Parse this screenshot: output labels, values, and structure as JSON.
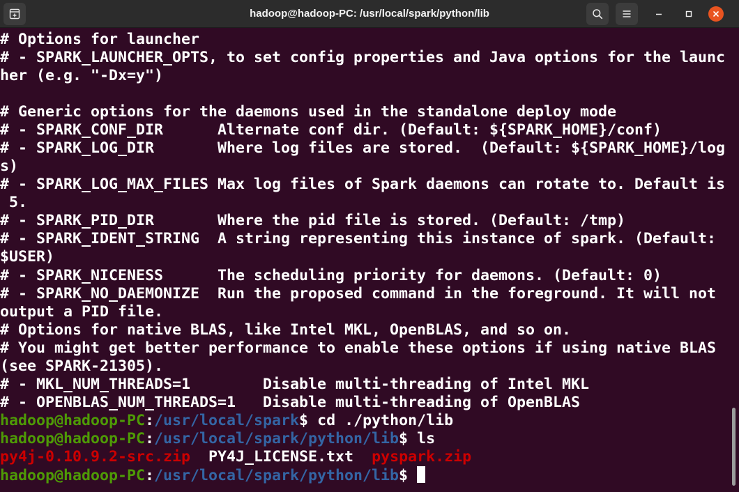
{
  "window": {
    "title": "hadoop@hadoop-PC: /usr/local/spark/python/lib"
  },
  "titlebar": {
    "icons": {
      "new_tab": "new-tab-icon",
      "search": "search-icon",
      "menu": "hamburger-menu-icon",
      "minimize": "minimize-icon",
      "maximize": "maximize-icon",
      "close": "close-icon"
    }
  },
  "colors": {
    "background": "#300a24",
    "prompt_user": "#4e9a06",
    "prompt_path": "#3465a4",
    "archive_file": "#cc0000",
    "close_button": "#e95420"
  },
  "terminal": {
    "output_lines": [
      "# Options for launcher",
      "# - SPARK_LAUNCHER_OPTS, to set config properties and Java options for the launc",
      "her (e.g. \"-Dx=y\")",
      "",
      "# Generic options for the daemons used in the standalone deploy mode",
      "# - SPARK_CONF_DIR      Alternate conf dir. (Default: ${SPARK_HOME}/conf)",
      "# - SPARK_LOG_DIR       Where log files are stored.  (Default: ${SPARK_HOME}/log",
      "s)",
      "# - SPARK_LOG_MAX_FILES Max log files of Spark daemons can rotate to. Default is",
      " 5.",
      "# - SPARK_PID_DIR       Where the pid file is stored. (Default: /tmp)",
      "# - SPARK_IDENT_STRING  A string representing this instance of spark. (Default:",
      "$USER)",
      "# - SPARK_NICENESS      The scheduling priority for daemons. (Default: 0)",
      "# - SPARK_NO_DAEMONIZE  Run the proposed command in the foreground. It will not",
      "output a PID file.",
      "# Options for native BLAS, like Intel MKL, OpenBLAS, and so on.",
      "# You might get better performance to enable these options if using native BLAS",
      "(see SPARK-21305).",
      "# - MKL_NUM_THREADS=1        Disable multi-threading of Intel MKL",
      "# - OPENBLAS_NUM_THREADS=1   Disable multi-threading of OpenBLAS"
    ],
    "prompt_user": "hadoop@hadoop-PC",
    "prompt_sep": ":",
    "prompt_end": "$ ",
    "commands": [
      {
        "path": "/usr/local/spark",
        "command": "cd ./python/lib"
      },
      {
        "path": "/usr/local/spark/python/lib",
        "command": "ls"
      }
    ],
    "ls_output": {
      "file1": "py4j-0.10.9.2-src.zip",
      "gap1": "  ",
      "file2": "PY4J_LICENSE.txt",
      "gap2": "  ",
      "file3": "pyspark.zip"
    },
    "current_prompt": {
      "path": "/usr/local/spark/python/lib"
    }
  }
}
